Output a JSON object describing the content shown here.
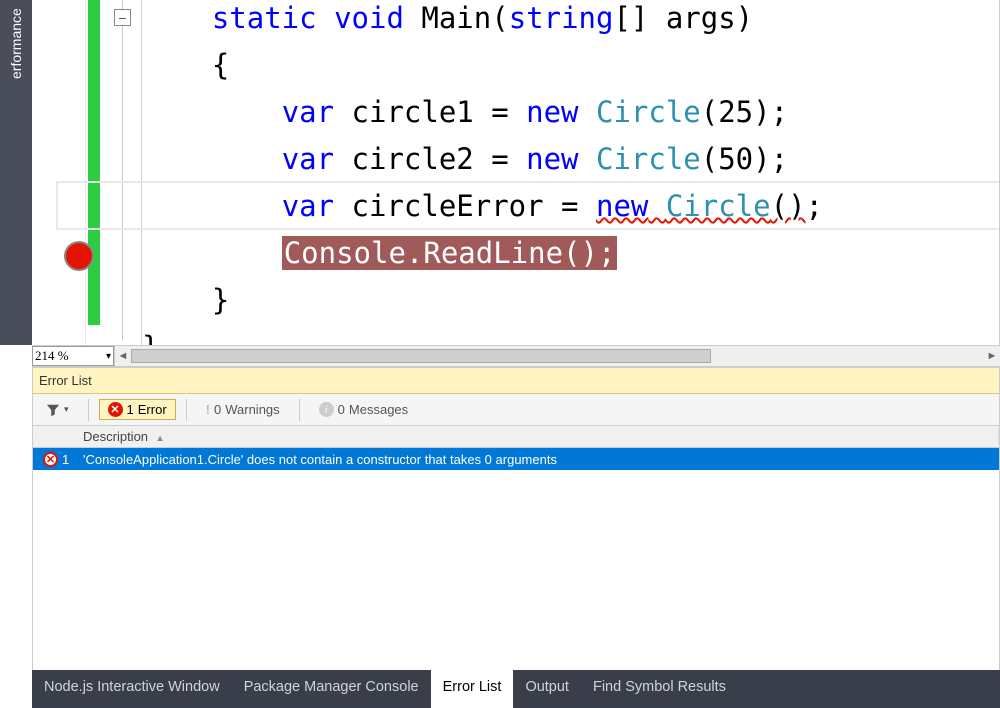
{
  "left_rail": {
    "label": "erformance"
  },
  "editor": {
    "fold_glyph": "−",
    "zoom": "214 %",
    "code": {
      "l1": {
        "a": "static",
        "b": "void",
        "c": "Main(",
        "d": "string",
        "e": "[] args)"
      },
      "l2": "{",
      "l3": {
        "a": "var",
        "b": " circle1 = ",
        "c": "new",
        "d": " ",
        "e": "Circle",
        "f": "(25);"
      },
      "l4": {
        "a": "var",
        "b": " circle2 = ",
        "c": "new",
        "d": " ",
        "e": "Circle",
        "f": "(50);"
      },
      "l5": {
        "a": "var",
        "b": " circleError = ",
        "c": "new",
        "d": " ",
        "e": "Circle",
        "f": "()",
        "g": ";"
      },
      "l6": "Console.ReadLine();",
      "l7": "}",
      "l8": "}"
    }
  },
  "error_panel": {
    "title": "Error List",
    "filters": {
      "errors": {
        "count": "1",
        "label": "Error"
      },
      "warnings": {
        "count": "0",
        "label": "Warnings"
      },
      "messages": {
        "count": "0",
        "label": "Messages"
      }
    },
    "columns": {
      "description": "Description"
    },
    "rows": [
      {
        "index": "1",
        "description": "'ConsoleApplication1.Circle' does not contain a constructor that takes 0 arguments"
      }
    ]
  },
  "window_tabs": {
    "t1": "Node.js Interactive Window",
    "t2": "Package Manager Console",
    "t3": "Error List",
    "t4": "Output",
    "t5": "Find Symbol Results"
  }
}
